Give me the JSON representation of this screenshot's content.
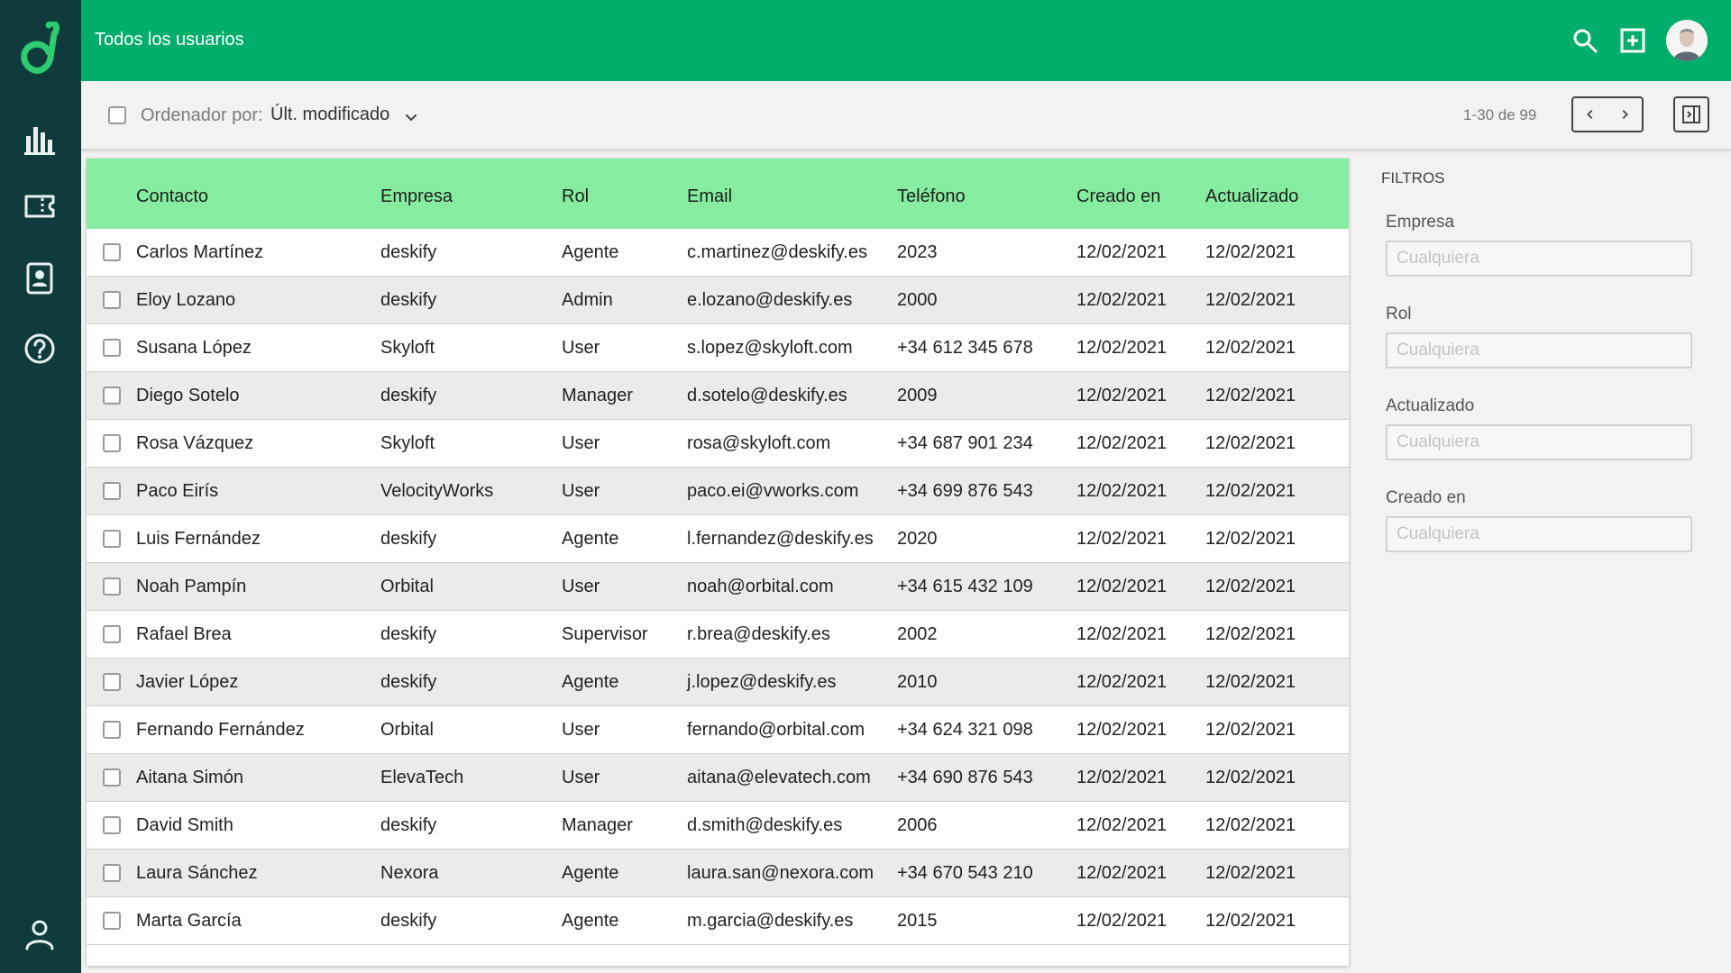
{
  "colors": {
    "sidebar": "#0f3b3c",
    "topbar": "#00ad6b",
    "accent": "#2ecc71",
    "table_header": "#86ec9f"
  },
  "sidebar": {
    "items": [
      {
        "icon": "bar-chart-icon",
        "label": ""
      },
      {
        "icon": "ticket-icon",
        "label": ""
      },
      {
        "icon": "contact-card-icon",
        "label": ""
      },
      {
        "icon": "help-icon",
        "label": ""
      },
      {
        "icon": "user-profile-icon",
        "label": ""
      }
    ]
  },
  "header": {
    "title": "Todos los usuarios"
  },
  "toolbar": {
    "sort_label": "Ordenador por:",
    "sort_value": "Últ. modificado",
    "page_range": "1-30 de 99"
  },
  "table": {
    "columns": [
      "Contacto",
      "Empresa",
      "Rol",
      "Email",
      "Teléfono",
      "Creado en",
      "Actualizado"
    ],
    "rows": [
      [
        "Carlos Martínez",
        "deskify",
        "Agente",
        "c.martinez@deskify.es",
        "2023",
        "12/02/2021",
        "12/02/2021"
      ],
      [
        "Eloy Lozano",
        "deskify",
        "Admin",
        "e.lozano@deskify.es",
        "2000",
        "12/02/2021",
        "12/02/2021"
      ],
      [
        "Susana López",
        "Skyloft",
        "User",
        "s.lopez@skyloft.com",
        "+34 612 345 678",
        "12/02/2021",
        "12/02/2021"
      ],
      [
        "Diego Sotelo",
        "deskify",
        "Manager",
        "d.sotelo@deskify.es",
        "2009",
        "12/02/2021",
        "12/02/2021"
      ],
      [
        "Rosa Vázquez",
        "Skyloft",
        "User",
        "rosa@skyloft.com",
        "+34 687 901 234",
        "12/02/2021",
        "12/02/2021"
      ],
      [
        "Paco Eirís",
        "VelocityWorks",
        "User",
        "paco.ei@vworks.com",
        "+34 699 876 543",
        "12/02/2021",
        "12/02/2021"
      ],
      [
        "Luis Fernández",
        "deskify",
        "Agente",
        "l.fernandez@deskify.es",
        "2020",
        "12/02/2021",
        "12/02/2021"
      ],
      [
        "Noah Pampín",
        "Orbital",
        "User",
        "noah@orbital.com",
        "+34 615 432 109",
        "12/02/2021",
        "12/02/2021"
      ],
      [
        "Rafael Brea",
        "deskify",
        "Supervisor",
        "r.brea@deskify.es",
        "2002",
        "12/02/2021",
        "12/02/2021"
      ],
      [
        "Javier López",
        "deskify",
        "Agente",
        "j.lopez@deskify.es",
        "2010",
        "12/02/2021",
        "12/02/2021"
      ],
      [
        "Fernando Fernández",
        "Orbital",
        "User",
        "fernando@orbital.com",
        "+34 624 321 098",
        "12/02/2021",
        "12/02/2021"
      ],
      [
        "Aitana Simón",
        "ElevaTech",
        "User",
        "aitana@elevatech.com",
        "+34 690 876 543",
        "12/02/2021",
        "12/02/2021"
      ],
      [
        "David Smith",
        "deskify",
        "Manager",
        "d.smith@deskify.es",
        "2006",
        "12/02/2021",
        "12/02/2021"
      ],
      [
        "Laura Sánchez",
        "Nexora",
        "Agente",
        "laura.san@nexora.com",
        "+34 670 543 210",
        "12/02/2021",
        "12/02/2021"
      ],
      [
        "Marta García",
        "deskify",
        "Agente",
        "m.garcia@deskify.es",
        "2015",
        "12/02/2021",
        "12/02/2021"
      ]
    ]
  },
  "filters": {
    "title": "FILTROS",
    "fields": [
      {
        "label": "Empresa",
        "placeholder": "Cualquiera"
      },
      {
        "label": "Rol",
        "placeholder": "Cualquiera"
      },
      {
        "label": "Actualizado",
        "placeholder": "Cualquiera"
      },
      {
        "label": "Creado en",
        "placeholder": "Cualquiera"
      }
    ]
  }
}
